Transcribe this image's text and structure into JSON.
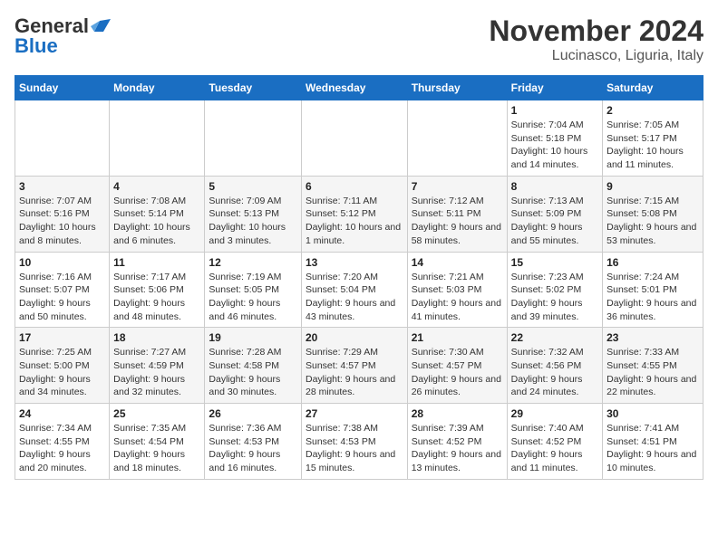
{
  "header": {
    "logo_line1": "General",
    "logo_line2": "Blue",
    "month": "November 2024",
    "location": "Lucinasco, Liguria, Italy"
  },
  "weekdays": [
    "Sunday",
    "Monday",
    "Tuesday",
    "Wednesday",
    "Thursday",
    "Friday",
    "Saturday"
  ],
  "weeks": [
    [
      {
        "day": "",
        "info": ""
      },
      {
        "day": "",
        "info": ""
      },
      {
        "day": "",
        "info": ""
      },
      {
        "day": "",
        "info": ""
      },
      {
        "day": "",
        "info": ""
      },
      {
        "day": "1",
        "info": "Sunrise: 7:04 AM\nSunset: 5:18 PM\nDaylight: 10 hours and 14 minutes."
      },
      {
        "day": "2",
        "info": "Sunrise: 7:05 AM\nSunset: 5:17 PM\nDaylight: 10 hours and 11 minutes."
      }
    ],
    [
      {
        "day": "3",
        "info": "Sunrise: 7:07 AM\nSunset: 5:16 PM\nDaylight: 10 hours and 8 minutes."
      },
      {
        "day": "4",
        "info": "Sunrise: 7:08 AM\nSunset: 5:14 PM\nDaylight: 10 hours and 6 minutes."
      },
      {
        "day": "5",
        "info": "Sunrise: 7:09 AM\nSunset: 5:13 PM\nDaylight: 10 hours and 3 minutes."
      },
      {
        "day": "6",
        "info": "Sunrise: 7:11 AM\nSunset: 5:12 PM\nDaylight: 10 hours and 1 minute."
      },
      {
        "day": "7",
        "info": "Sunrise: 7:12 AM\nSunset: 5:11 PM\nDaylight: 9 hours and 58 minutes."
      },
      {
        "day": "8",
        "info": "Sunrise: 7:13 AM\nSunset: 5:09 PM\nDaylight: 9 hours and 55 minutes."
      },
      {
        "day": "9",
        "info": "Sunrise: 7:15 AM\nSunset: 5:08 PM\nDaylight: 9 hours and 53 minutes."
      }
    ],
    [
      {
        "day": "10",
        "info": "Sunrise: 7:16 AM\nSunset: 5:07 PM\nDaylight: 9 hours and 50 minutes."
      },
      {
        "day": "11",
        "info": "Sunrise: 7:17 AM\nSunset: 5:06 PM\nDaylight: 9 hours and 48 minutes."
      },
      {
        "day": "12",
        "info": "Sunrise: 7:19 AM\nSunset: 5:05 PM\nDaylight: 9 hours and 46 minutes."
      },
      {
        "day": "13",
        "info": "Sunrise: 7:20 AM\nSunset: 5:04 PM\nDaylight: 9 hours and 43 minutes."
      },
      {
        "day": "14",
        "info": "Sunrise: 7:21 AM\nSunset: 5:03 PM\nDaylight: 9 hours and 41 minutes."
      },
      {
        "day": "15",
        "info": "Sunrise: 7:23 AM\nSunset: 5:02 PM\nDaylight: 9 hours and 39 minutes."
      },
      {
        "day": "16",
        "info": "Sunrise: 7:24 AM\nSunset: 5:01 PM\nDaylight: 9 hours and 36 minutes."
      }
    ],
    [
      {
        "day": "17",
        "info": "Sunrise: 7:25 AM\nSunset: 5:00 PM\nDaylight: 9 hours and 34 minutes."
      },
      {
        "day": "18",
        "info": "Sunrise: 7:27 AM\nSunset: 4:59 PM\nDaylight: 9 hours and 32 minutes."
      },
      {
        "day": "19",
        "info": "Sunrise: 7:28 AM\nSunset: 4:58 PM\nDaylight: 9 hours and 30 minutes."
      },
      {
        "day": "20",
        "info": "Sunrise: 7:29 AM\nSunset: 4:57 PM\nDaylight: 9 hours and 28 minutes."
      },
      {
        "day": "21",
        "info": "Sunrise: 7:30 AM\nSunset: 4:57 PM\nDaylight: 9 hours and 26 minutes."
      },
      {
        "day": "22",
        "info": "Sunrise: 7:32 AM\nSunset: 4:56 PM\nDaylight: 9 hours and 24 minutes."
      },
      {
        "day": "23",
        "info": "Sunrise: 7:33 AM\nSunset: 4:55 PM\nDaylight: 9 hours and 22 minutes."
      }
    ],
    [
      {
        "day": "24",
        "info": "Sunrise: 7:34 AM\nSunset: 4:55 PM\nDaylight: 9 hours and 20 minutes."
      },
      {
        "day": "25",
        "info": "Sunrise: 7:35 AM\nSunset: 4:54 PM\nDaylight: 9 hours and 18 minutes."
      },
      {
        "day": "26",
        "info": "Sunrise: 7:36 AM\nSunset: 4:53 PM\nDaylight: 9 hours and 16 minutes."
      },
      {
        "day": "27",
        "info": "Sunrise: 7:38 AM\nSunset: 4:53 PM\nDaylight: 9 hours and 15 minutes."
      },
      {
        "day": "28",
        "info": "Sunrise: 7:39 AM\nSunset: 4:52 PM\nDaylight: 9 hours and 13 minutes."
      },
      {
        "day": "29",
        "info": "Sunrise: 7:40 AM\nSunset: 4:52 PM\nDaylight: 9 hours and 11 minutes."
      },
      {
        "day": "30",
        "info": "Sunrise: 7:41 AM\nSunset: 4:51 PM\nDaylight: 9 hours and 10 minutes."
      }
    ]
  ]
}
